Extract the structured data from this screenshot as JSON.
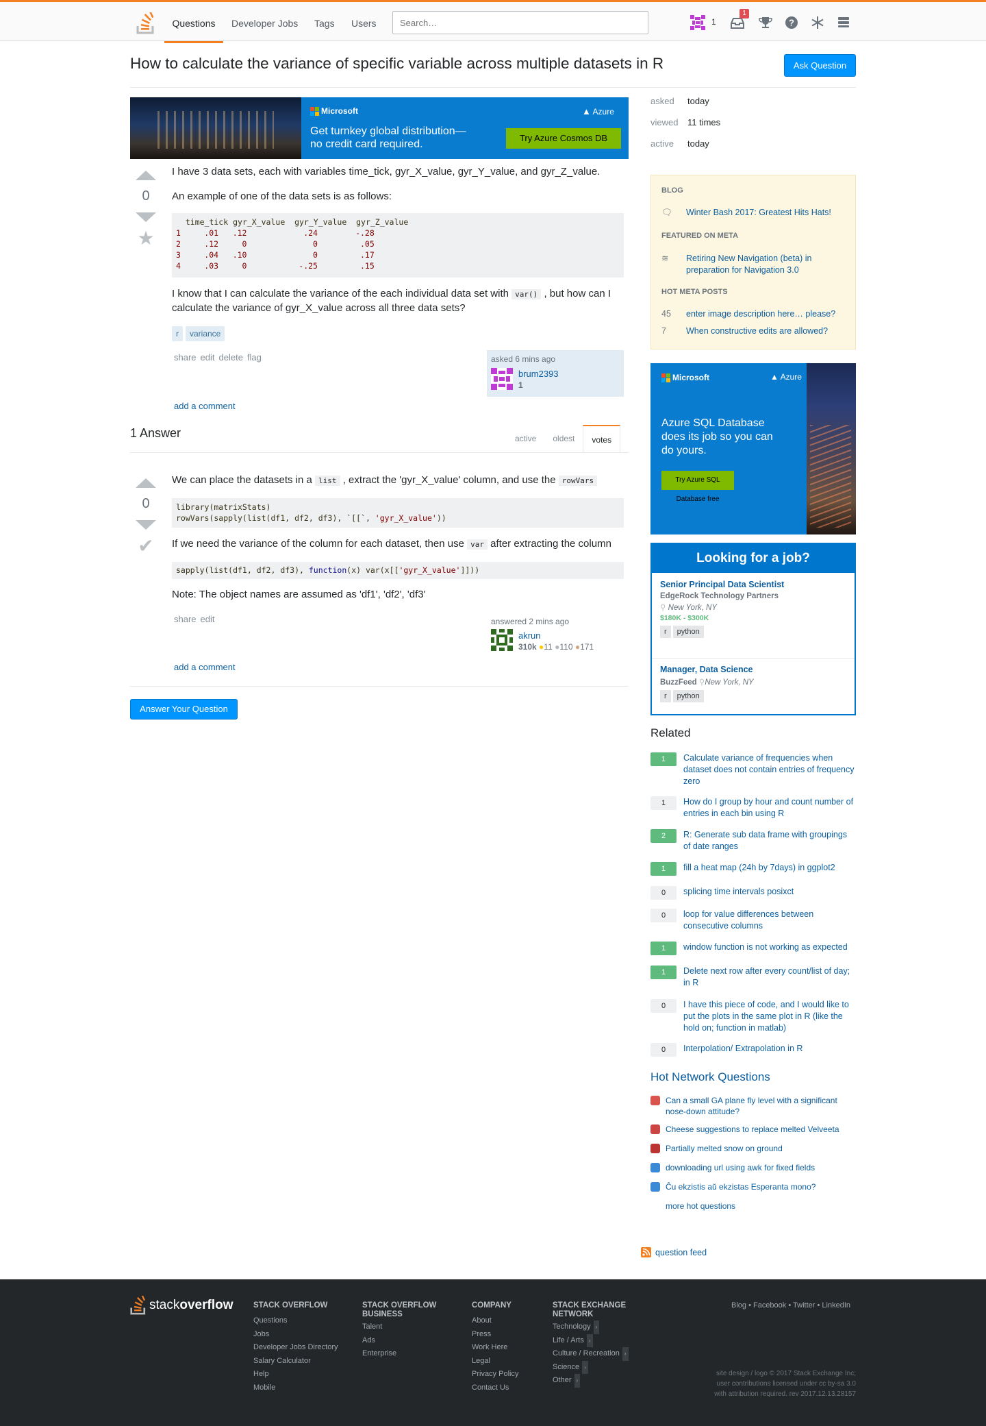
{
  "topbar": {
    "nav": [
      "Questions",
      "Developer Jobs",
      "Tags",
      "Users"
    ],
    "search_placeholder": "Search…",
    "reputation": "1",
    "inbox_count": "1"
  },
  "question": {
    "title": "How to calculate the variance of specific variable across multiple datasets in R",
    "ask_button": "Ask Question",
    "votes": "0",
    "p1": "I have 3 data sets, each with variables time_tick, gyr_X_value, gyr_Y_value, and gyr_Z_value.",
    "p2": "An example of one of the data sets is as follows:",
    "code_header": "  time_tick gyr_X_value  gyr_Y_value  gyr_Z_value",
    "code_rows": [
      [
        "1",
        ".01",
        ".12",
        ".24",
        "-.28"
      ],
      [
        "2",
        ".12",
        "0",
        "0",
        ".05"
      ],
      [
        "3",
        ".04",
        ".10",
        "0",
        ".17"
      ],
      [
        "4",
        ".03",
        "0",
        "-.25",
        ".15"
      ]
    ],
    "p3a": "I know that I can calculate the variance of the each individual data set with",
    "p3code": "var()",
    "p3b": ", but how can I",
    "p3c": "calculate the variance of gyr_X_value across all three data sets?",
    "tags": [
      "r",
      "variance"
    ],
    "actions": [
      "share",
      "edit",
      "delete",
      "flag"
    ],
    "asked": "asked 6 mins ago",
    "user": "brum2393",
    "user_rep": "1",
    "add_comment": "add a comment"
  },
  "answers": {
    "count_label": "1 Answer",
    "tabs": [
      "active",
      "oldest",
      "votes"
    ],
    "answer": {
      "votes": "0",
      "p1a": "We can place the datasets in a",
      "p1code1": "list",
      "p1b": ", extract the 'gyr_X_value' column, and use the",
      "p1code2": "rowVars",
      "code1_l1": "library(matrixStats)",
      "code1_l2a": "rowVars(sapply(list(df1, df2, df3), `[[`, ",
      "code1_l2s": "'gyr_X_value'",
      "code1_l2b": "))",
      "p2a": "If we need the variance of the column for each dataset, then use",
      "p2code": "var",
      "p2b": "after extracting the column",
      "code2a": "sapply(list(df1, df2, df3), ",
      "code2kw": "function",
      "code2b": "(x) var(x[[",
      "code2s": "'gyr_X_value'",
      "code2c": "]]))",
      "p3": "Note: The object names are assumed as 'df1', 'df2', 'df3'",
      "actions": [
        "share",
        "edit"
      ],
      "answered": "answered 2 mins ago",
      "user": "akrun",
      "rep": "310k",
      "gold": "11",
      "silver": "110",
      "bronze": "171",
      "add_comment": "add a comment"
    },
    "answer_button": "Answer Your Question"
  },
  "ad_top": {
    "brand": "Microsoft",
    "product": "Azure",
    "text": "Get turnkey global distribution—\nno credit card required.",
    "button": "Try Azure Cosmos DB"
  },
  "sidebar": {
    "info": [
      {
        "k": "asked",
        "v": "today"
      },
      {
        "k": "viewed",
        "v": "11 times"
      },
      {
        "k": "active",
        "v": "today"
      }
    ],
    "blog_h": "BLOG",
    "blog_item": "Winter Bash 2017: Greatest Hits Hats!",
    "meta_h": "FEATURED ON META",
    "meta_item": "Retiring New Navigation (beta) in preparation for Navigation 3.0",
    "hot_h": "HOT META POSTS",
    "hot_meta": [
      {
        "n": "45",
        "t": "enter image description here… please?"
      },
      {
        "n": "7",
        "t": "When constructive edits are allowed?"
      }
    ],
    "ad2": {
      "brand": "Microsoft",
      "product": "Azure",
      "text": "Azure SQL Database does its job so you can do yours.",
      "button": "Try Azure SQL Database free"
    },
    "jobs_h": "Looking for a job?",
    "jobs": [
      {
        "title": "Senior Principal Data Scientist",
        "company": "EdgeRock Technology Partners",
        "loc": "New York, NY",
        "salary": "$180K - $300K",
        "tags": [
          "r",
          "python"
        ]
      },
      {
        "title": "Manager, Data Science",
        "company": "BuzzFeed",
        "loc": "New York, NY",
        "tags": [
          "r",
          "python"
        ]
      }
    ],
    "related_h": "Related",
    "related": [
      {
        "s": "1",
        "t": "Calculate variance of frequencies when dataset does not contain entries of frequency zero"
      },
      {
        "s": "1",
        "t": "How do I group by hour and count number of entries in each bin using R"
      },
      {
        "s": "2",
        "t": "R: Generate sub data frame with groupings of date ranges"
      },
      {
        "s": "1",
        "t": "fill a heat map (24h by 7days) in ggplot2"
      },
      {
        "s": "0",
        "t": "splicing time intervals posixct"
      },
      {
        "s": "0",
        "t": "loop for value differences between consecutive columns"
      },
      {
        "s": "1",
        "t": "window function is not working as expected"
      },
      {
        "s": "1",
        "t": "Delete next row after every count/list of day; in R"
      },
      {
        "s": "0",
        "t": "I have this piece of code, and I would like to put the plots in the same plot in R (like the hold on; function in matlab)"
      },
      {
        "s": "0",
        "t": "Interpolation/ Extrapolation in R"
      }
    ],
    "hnq_h": "Hot Network Questions",
    "hnq": [
      "Can a small GA plane fly level with a significant nose-down attitude?",
      "Cheese suggestions to replace melted Velveeta",
      "Partially melted snow on ground",
      "downloading url using awk for fixed fields",
      "Ĉu ekzistis aŭ ekzistas Esperanta mono?"
    ],
    "more_hot": "more hot questions",
    "feed": "question feed"
  },
  "footer": {
    "logo_a": "stack",
    "logo_b": "overflow",
    "cols": [
      {
        "h": "STACK OVERFLOW",
        "items": [
          "Questions",
          "Jobs",
          "Developer Jobs Directory",
          "Salary Calculator",
          "Help",
          "Mobile"
        ]
      },
      {
        "h": "STACK OVERFLOW BUSINESS",
        "items": [
          "Talent",
          "Ads",
          "Enterprise"
        ]
      },
      {
        "h": "COMPANY",
        "items": [
          "About",
          "Press",
          "Work Here",
          "Legal",
          "Privacy Policy",
          "Contact Us"
        ]
      },
      {
        "h": "STACK EXCHANGE NETWORK",
        "items": [
          "Technology",
          "Life / Arts",
          "Culture / Recreation",
          "Science",
          "Other"
        ]
      }
    ],
    "social": "Blog • Facebook • Twitter • LinkedIn",
    "copy1": "site design / logo © 2017 Stack Exchange Inc;",
    "copy2": "user contributions licensed under cc by-sa 3.0",
    "copy3": "with attribution required. rev 2017.12.13.28157"
  }
}
